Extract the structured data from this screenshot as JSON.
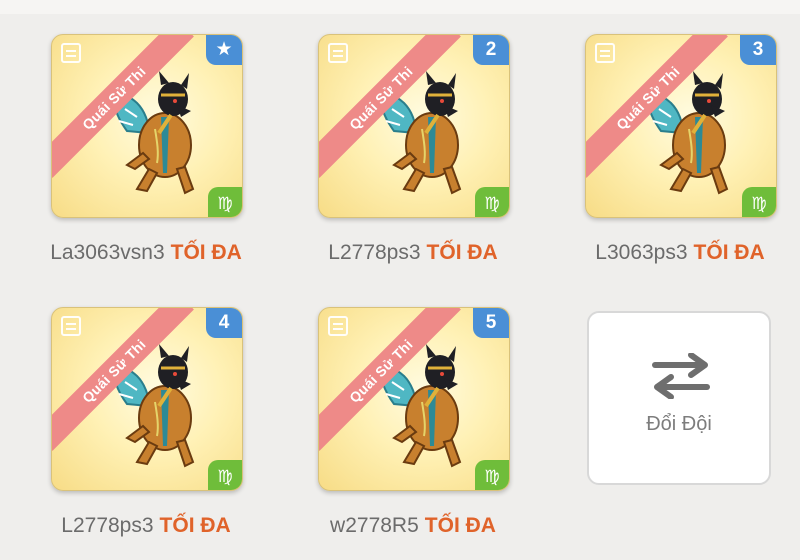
{
  "team": {
    "slots": [
      {
        "badge": "★",
        "name": "La3063vsn3",
        "level": "TỐI ĐA",
        "tag": "Quái Sử Thi",
        "element": "Virgo"
      },
      {
        "badge": "2",
        "name": "L2778ps3",
        "level": "TỐI ĐA",
        "tag": "Quái Sử Thi",
        "element": "Virgo"
      },
      {
        "badge": "3",
        "name": "L3063ps3",
        "level": "TỐI ĐA",
        "tag": "Quái Sử Thi",
        "element": "Virgo"
      },
      {
        "badge": "4",
        "name": "L2778ps3",
        "level": "TỐI ĐA",
        "tag": "Quái Sử Thi",
        "element": "Virgo"
      },
      {
        "badge": "5",
        "name": "w2778R5",
        "level": "TỐI ĐA",
        "tag": "Quái Sử Thi",
        "element": "Virgo"
      }
    ],
    "swap_button": {
      "label": "Đổi Đội",
      "icon": "swap-arrows-icon"
    }
  },
  "colors": {
    "background": "#efeeec",
    "banner": "#ee8a88",
    "badge": "#4a8fd6",
    "element": "#6fbd3a",
    "max_level": "#e0632a",
    "name": "#6b6b6b"
  }
}
